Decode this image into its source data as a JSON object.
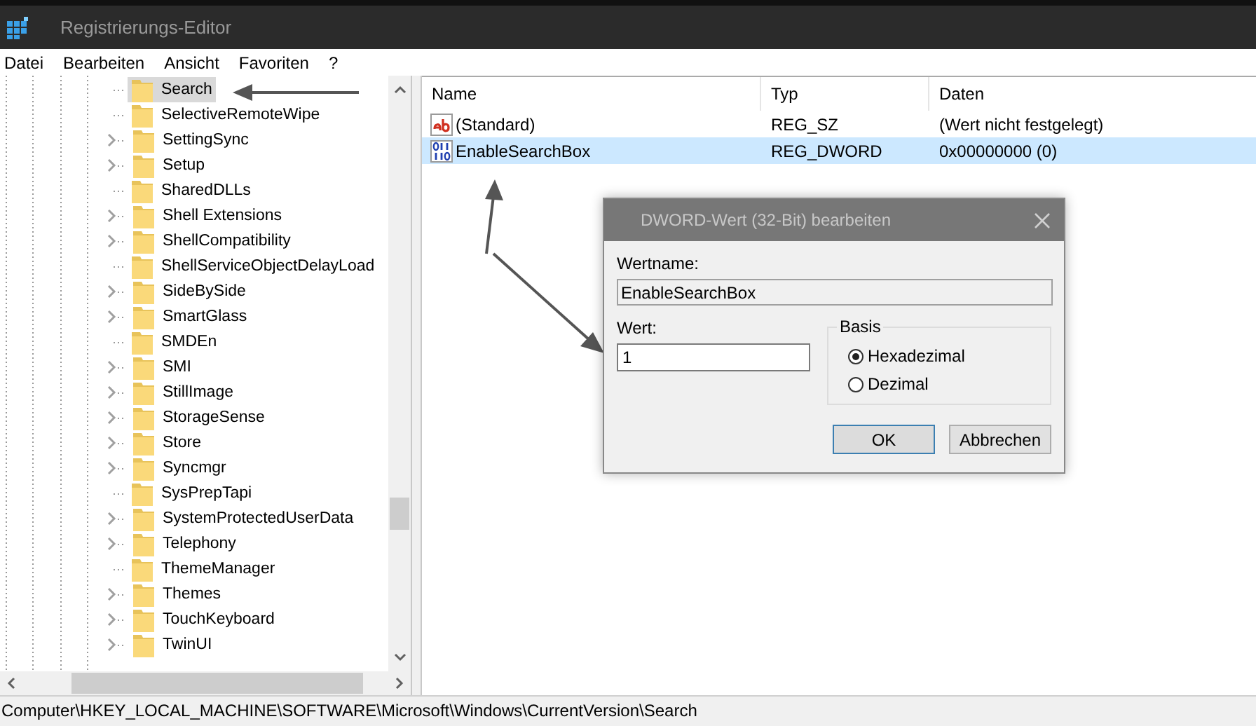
{
  "window": {
    "title": "Registrierungs-Editor"
  },
  "menu": [
    "Datei",
    "Bearbeiten",
    "Ansicht",
    "Favoriten",
    "?"
  ],
  "tree": {
    "items": [
      {
        "label": "Search",
        "expandable": false,
        "selected": true
      },
      {
        "label": "SelectiveRemoteWipe",
        "expandable": false,
        "selected": false
      },
      {
        "label": "SettingSync",
        "expandable": true,
        "selected": false
      },
      {
        "label": "Setup",
        "expandable": true,
        "selected": false
      },
      {
        "label": "SharedDLLs",
        "expandable": false,
        "selected": false
      },
      {
        "label": "Shell Extensions",
        "expandable": true,
        "selected": false
      },
      {
        "label": "ShellCompatibility",
        "expandable": true,
        "selected": false
      },
      {
        "label": "ShellServiceObjectDelayLoad",
        "expandable": false,
        "selected": false
      },
      {
        "label": "SideBySide",
        "expandable": true,
        "selected": false
      },
      {
        "label": "SmartGlass",
        "expandable": true,
        "selected": false
      },
      {
        "label": "SMDEn",
        "expandable": false,
        "selected": false
      },
      {
        "label": "SMI",
        "expandable": true,
        "selected": false
      },
      {
        "label": "StillImage",
        "expandable": true,
        "selected": false
      },
      {
        "label": "StorageSense",
        "expandable": true,
        "selected": false
      },
      {
        "label": "Store",
        "expandable": true,
        "selected": false
      },
      {
        "label": "Syncmgr",
        "expandable": true,
        "selected": false
      },
      {
        "label": "SysPrepTapi",
        "expandable": false,
        "selected": false
      },
      {
        "label": "SystemProtectedUserData",
        "expandable": true,
        "selected": false
      },
      {
        "label": "Telephony",
        "expandable": true,
        "selected": false
      },
      {
        "label": "ThemeManager",
        "expandable": false,
        "selected": false
      },
      {
        "label": "Themes",
        "expandable": true,
        "selected": false
      },
      {
        "label": "TouchKeyboard",
        "expandable": true,
        "selected": false
      },
      {
        "label": "TwinUI",
        "expandable": true,
        "selected": false
      }
    ]
  },
  "values": {
    "columns": [
      "Name",
      "Typ",
      "Daten"
    ],
    "rows": [
      {
        "kind": "string",
        "name": "(Standard)",
        "type": "REG_SZ",
        "data": "(Wert nicht festgelegt)",
        "selected": false
      },
      {
        "kind": "binary",
        "name": "EnableSearchBox",
        "type": "REG_DWORD",
        "data": "0x00000000 (0)",
        "selected": true
      }
    ]
  },
  "dialog": {
    "title": "DWORD-Wert (32-Bit) bearbeiten",
    "name_label": "Wertname:",
    "name_value": "EnableSearchBox",
    "value_label": "Wert:",
    "value": "1",
    "base_label": "Basis",
    "bases": [
      {
        "label": "Hexadezimal",
        "selected": true
      },
      {
        "label": "Dezimal",
        "selected": false
      }
    ],
    "buttons": [
      {
        "label": "OK",
        "default": true
      },
      {
        "label": "Abbrechen",
        "default": false
      }
    ]
  },
  "status_bar": "Computer\\HKEY_LOCAL_MACHINE\\SOFTWARE\\Microsoft\\Windows\\CurrentVersion\\Search"
}
